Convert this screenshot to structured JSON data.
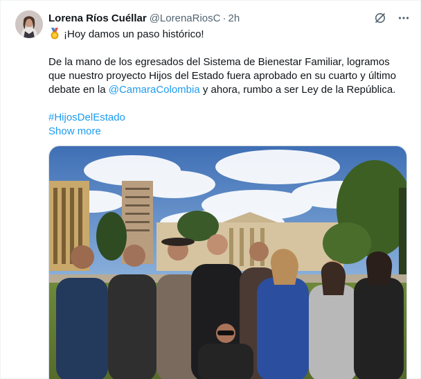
{
  "author": {
    "name": "Lorena Ríos Cuéllar",
    "handle": "@LorenaRiosC",
    "separator": "·",
    "time": "2h"
  },
  "tweet": {
    "line1": "¡Hoy damos un paso histórico!",
    "para2_part1": "De la mano de los egresados del Sistema de Bienestar Familiar, logramos que nuestro proyecto Hijos del Estado fuera aprobado en su cuarto y último debate en la ",
    "mention": "@CamaraColombia",
    "para2_part2": " y ahora, rumbo a ser Ley de la República.",
    "hashtag": "#HijosDelEstado",
    "show_more": "Show more"
  },
  "icons": {
    "grok": "grok-icon",
    "more": "more-icon",
    "medal": "medal-icon"
  },
  "colors": {
    "link": "#1d9bf0",
    "text": "#0f1419",
    "secondary": "#536471"
  }
}
